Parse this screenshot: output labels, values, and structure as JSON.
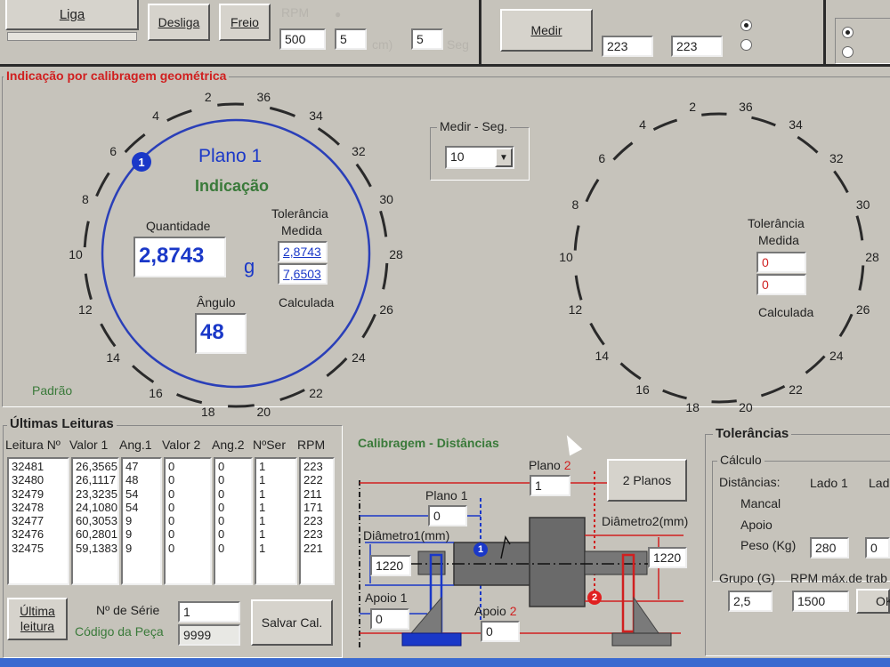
{
  "toolbar": {
    "liga": "Liga",
    "desliga": "Desliga",
    "freio": "Freio",
    "medir": "Medir",
    "rpm_label": "RPM",
    "rpm_value": "500",
    "field2_value": "5",
    "field3_value": "5",
    "cm_label": "cm)",
    "seg_label": "Seg",
    "medir_rpm1": "223",
    "medir_rpm2": "223"
  },
  "geo": {
    "title": "Indicação por calibragem geométrica",
    "dial_labels": [
      "2",
      "36",
      "34",
      "32",
      "30",
      "28",
      "26",
      "24",
      "22",
      "20",
      "18",
      "16",
      "14",
      "12",
      "10",
      "8",
      "6",
      "4"
    ],
    "plano_marker": "1",
    "plano_title": "Plano 1",
    "indicacao": "Indicação",
    "quantidade_label": "Quantidade",
    "quantidade_value": "2,8743",
    "unit": "g",
    "tolerancia_label": "Tolerância",
    "medida_label": "Medida",
    "tol_medida": "2,8743",
    "tol_calc": "7,6503",
    "calculada_label": "Calculada",
    "angulo_label": "Ângulo",
    "angulo_value": "48",
    "padrao": "Padrão"
  },
  "medir_seg": {
    "title": "Medir - Seg.",
    "value": "10"
  },
  "right_dial": {
    "tolerancia_label": "Tolerância",
    "medida_label": "Medida",
    "medida_value": "0",
    "calc_value": "0",
    "calculada_label": "Calculada"
  },
  "leituras": {
    "title": "Últimas Leituras",
    "headers": [
      "Leitura Nº",
      "Valor 1",
      "Ang.1",
      "Valor 2",
      "Ang.2",
      "NºSer",
      "RPM"
    ],
    "columns": [
      [
        "32481",
        "32480",
        "32479",
        "32478",
        "32477",
        "32476",
        "32475"
      ],
      [
        "26,3565",
        "26,1117",
        "23,3235",
        "24,1080",
        "60,3053",
        "60,2801",
        "59,1383"
      ],
      [
        "47",
        "48",
        "54",
        "54",
        "9",
        "9",
        "9"
      ],
      [
        "0",
        "0",
        "0",
        "0",
        "0",
        "0",
        "0"
      ],
      [
        "0",
        "0",
        "0",
        "0",
        "0",
        "0",
        "0"
      ],
      [
        "1",
        "1",
        "1",
        "1",
        "1",
        "1",
        "1"
      ],
      [
        "223",
        "222",
        "211",
        "171",
        "223",
        "223",
        "221"
      ]
    ],
    "ultima_btn": "Última leitura",
    "serie_label": "Nº de Série",
    "serie_value": "1",
    "codigo_label": "Código da Peça",
    "codigo_value": "9999",
    "salvar_btn": "Salvar Cal."
  },
  "calib": {
    "title": "Calibragem - Distâncias",
    "plano2_label": "Plano",
    "plano2_num": "2",
    "plano2_value": "1",
    "plano1_label": "Plano 1",
    "plano1_value": "0",
    "dois_planos_btn": "2 Planos",
    "diam1_label": "Diâmetro1(mm)",
    "diam1_value": "1220",
    "diam2_label": "Diâmetro2(mm)",
    "diam2_value": "1220",
    "apoio1_label": "Apoio 1",
    "apoio1_value": "0",
    "apoio2_label": "Apoio",
    "apoio2_num": "2",
    "apoio2_value": "0",
    "marker1": "1",
    "marker2": "2"
  },
  "tolerancias": {
    "title": "Tolerâncias",
    "calculo": "Cálculo",
    "distancias": "Distâncias:",
    "lado1": "Lado 1",
    "lado2": "Lad",
    "mancal": "Mancal",
    "apoio": "Apoio",
    "peso": "Peso (Kg)",
    "peso_value": "280",
    "peso_value2": "0",
    "grupo": "Grupo (G)",
    "grupo_value": "2,5",
    "rpm_max": "RPM máx.de trab",
    "rpm_max_value": "1500",
    "ok": "OK"
  }
}
